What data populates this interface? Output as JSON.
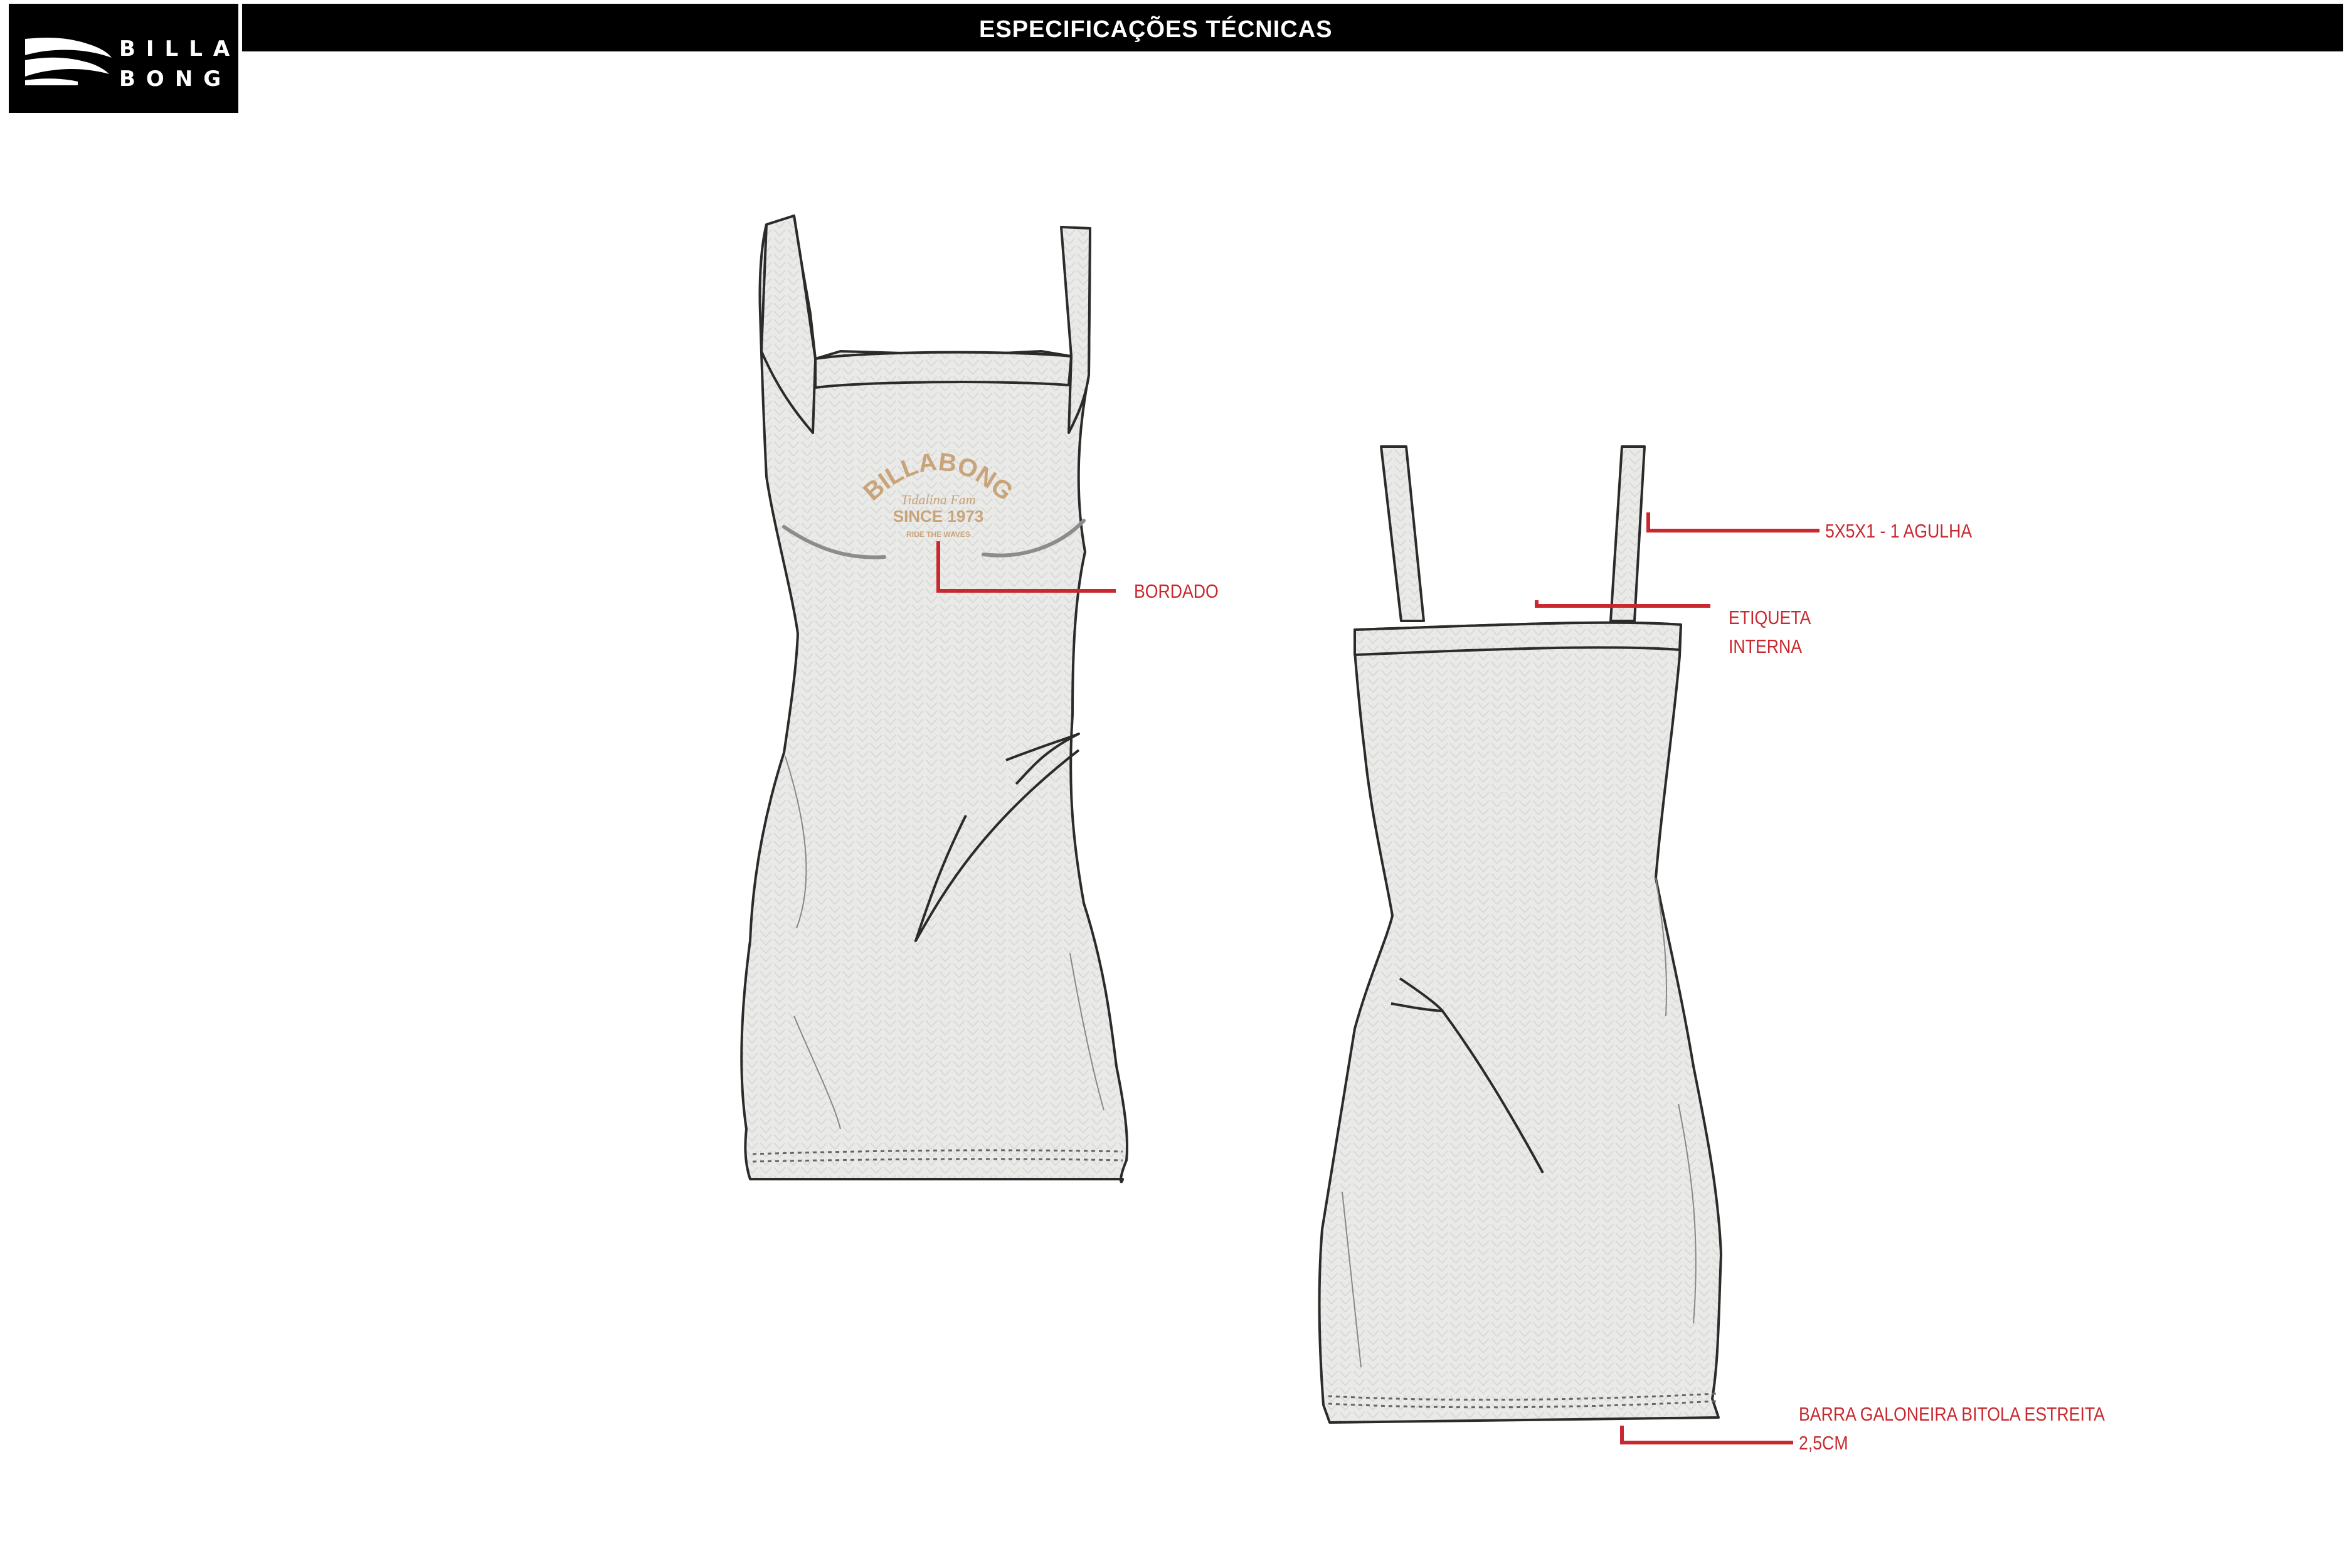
{
  "header": {
    "title": "ESPECIFICAÇÕES TÉCNICAS",
    "logo_line1": "BILLA",
    "logo_line2": "BONG"
  },
  "embroidery": {
    "brand": "BILLABONG",
    "script": "Tidalina Fam",
    "since": "SINCE 1973",
    "small": "RIDE THE WAVES"
  },
  "callouts": {
    "embroidery": "BORDADO",
    "strap": "5X5X1 - 1 AGULHA",
    "label": "ETIQUETA\nINTERNA",
    "hem": "BARRA GALONEIRA BITOLA ESTREITA\n2,5CM"
  },
  "colors": {
    "callout_red": "#c8282e",
    "fabric": "#eaeae8",
    "embroidery_gold": "#c9a47a",
    "outline": "#2b2b2b"
  }
}
